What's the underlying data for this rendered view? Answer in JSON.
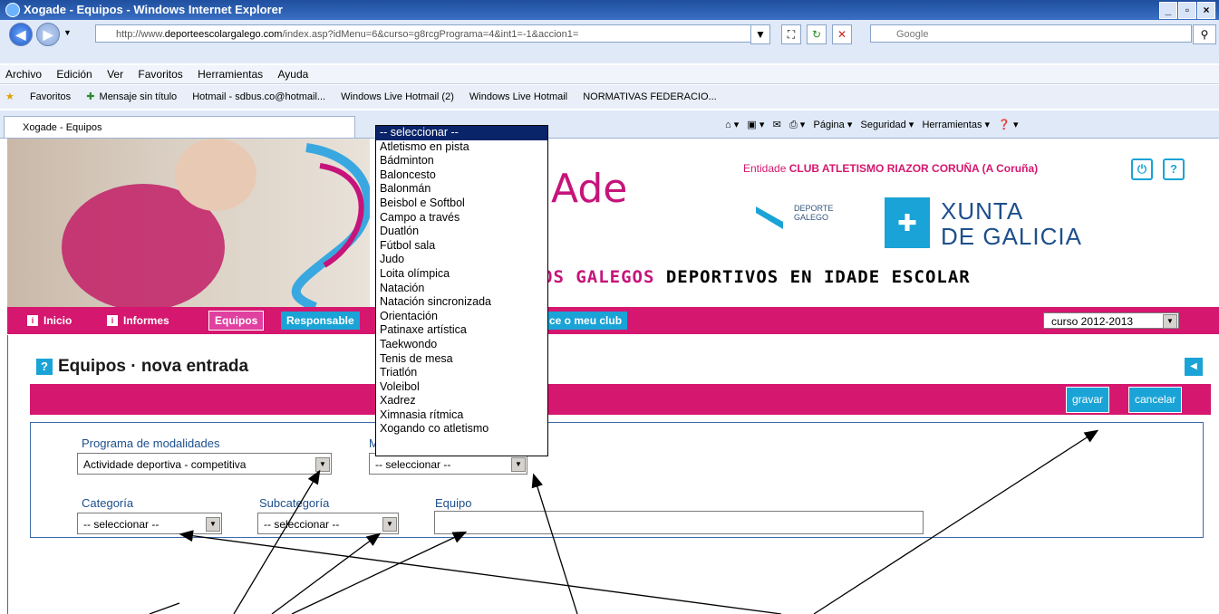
{
  "window": {
    "title": "Xogade - Equipos - Windows Internet Explorer",
    "url_prefix": "http://www.",
    "url_domain": "deporteescolargalego.com",
    "url_path": "/index.asp?idMenu=6&curso=g8rcgPrograma=4&int1=-1&accion1=",
    "search_placeholder": "Google"
  },
  "menu": [
    "Archivo",
    "Edición",
    "Ver",
    "Favoritos",
    "Herramientas",
    "Ayuda"
  ],
  "favorites": [
    "Favoritos",
    "Mensaje sin título",
    "Hotmail - sdbus.co@hotmail...",
    "Windows Live Hotmail (2)",
    "Windows Live Hotmail",
    "NORMATIVAS FEDERACIO..."
  ],
  "tab": {
    "label": "Xogade - Equipos"
  },
  "command_bar": [
    "Página",
    "Seguridad",
    "Herramientas"
  ],
  "header": {
    "entity_prefix": "Entidade",
    "entity_name": "CLUB ATLETISMO RIAZOR CORUÑA (A Coruña)",
    "logo_text": "Ade",
    "deporte_line1": "DEPORTE",
    "deporte_line2": "GALEGO",
    "xunta_line1": "XUNTA",
    "xunta_line2": "DE GALICIA",
    "slogan_pink": "OS GALEGOS",
    "slogan_dark": "DEPORTIVOS EN IDADE ESCOLAR"
  },
  "nav": {
    "inicio": "Inicio",
    "informes": "Informes",
    "equipos": "Equipos",
    "responsable": "Responsable",
    "club": "ce o meu club",
    "curso": "curso 2012-2013"
  },
  "page": {
    "title": "Equipos · nova entrada",
    "save": "gravar",
    "cancel": "cancelar"
  },
  "form": {
    "programa_label": "Programa de modalidades",
    "programa_value": "Actividade deportiva - competitiva",
    "modalidade_label_visible": "M",
    "modalidade_value": "-- seleccionar --",
    "categoria_label": "Categoría",
    "categoria_value": "-- seleccionar --",
    "subcategoria_label": "Subcategoría",
    "subcategoria_value": "-- seleccionar --",
    "equipo_label": "Equipo",
    "equipo_value": ""
  },
  "dropdown_options": [
    "-- seleccionar --",
    "Atletismo en pista",
    "Bádminton",
    "Baloncesto",
    "Balonmán",
    "Beisbol e Softbol",
    "Campo a través",
    "Duatlón",
    "Fútbol sala",
    "Judo",
    "Loita olímpica",
    "Natación",
    "Natación sincronizada",
    "Orientación",
    "Patinaxe artística",
    "Taekwondo",
    "Tenis de mesa",
    "Triatlón",
    "Voleibol",
    "Xadrez",
    "Ximnasia rítmica",
    "Xogando co atletismo"
  ],
  "colors": {
    "brand_pink": "#d5176f",
    "accent_blue": "#1aa3d6",
    "label_blue": "#1d4f8c"
  }
}
